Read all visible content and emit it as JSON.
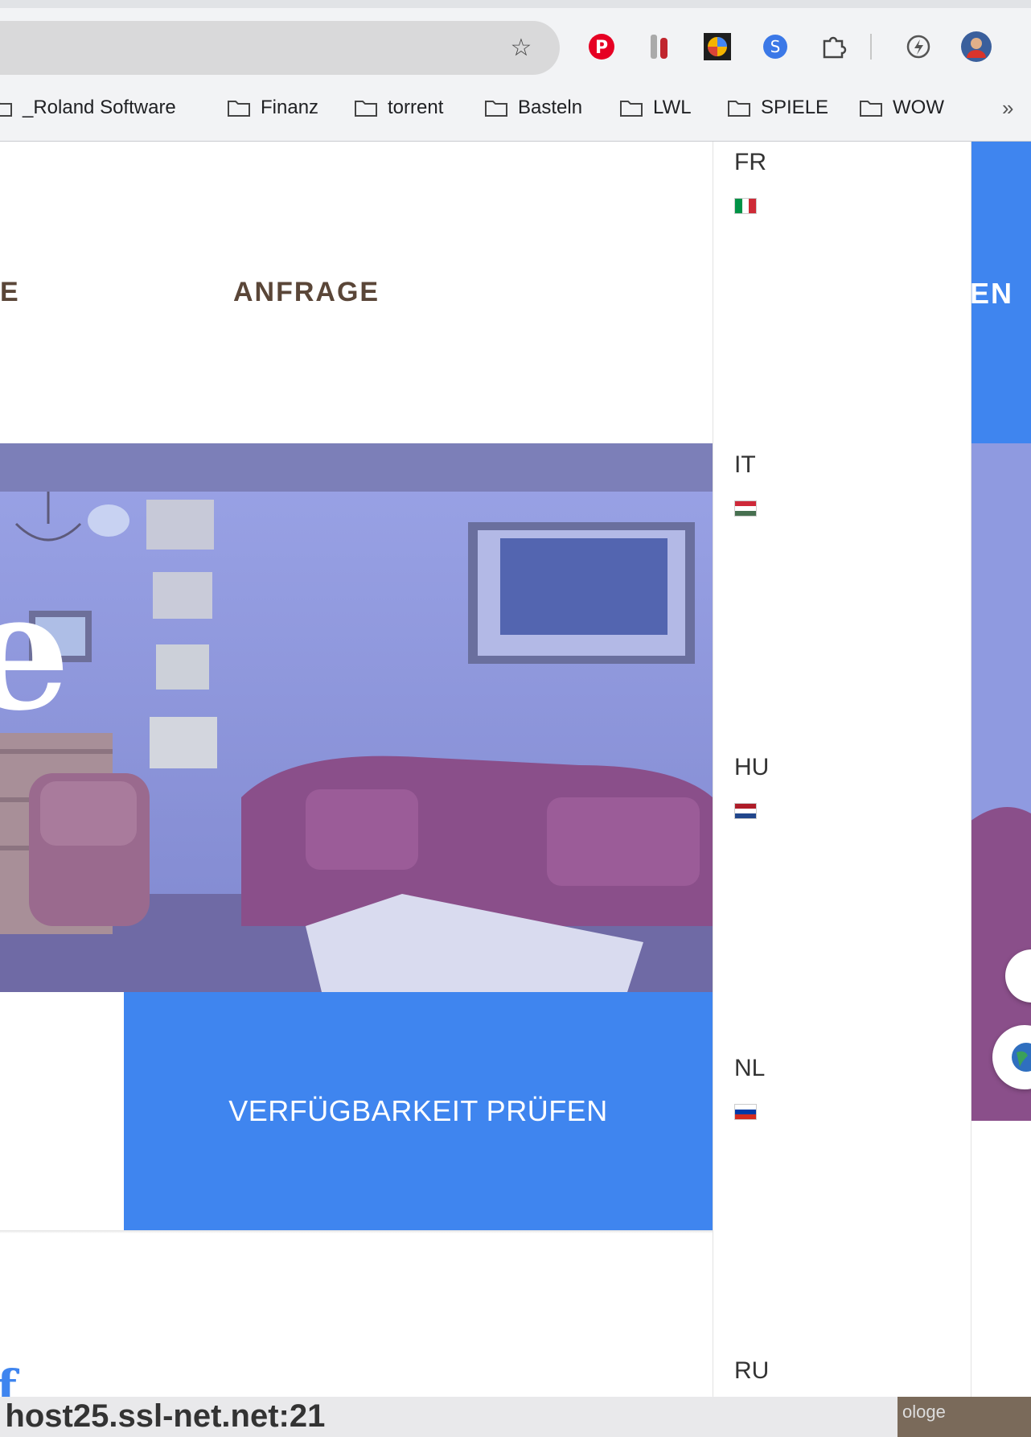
{
  "browser": {
    "bookmarks": [
      "_Roland Software",
      "Finanz",
      "torrent",
      "Basteln",
      "LWL",
      "SPIELE",
      "WOW"
    ],
    "extensions": [
      "pinterest-icon",
      "wine-tools-icon",
      "colorful-tile-icon",
      "blue-s-icon",
      "puzzle-extensions-icon",
      "lightning-icon",
      "profile-avatar-icon"
    ]
  },
  "page": {
    "nav_fragment": "E",
    "nav_anfrage": "ANFRAGE",
    "right_nav_fragment": "EN",
    "hero_letter": "e",
    "booking_button": "VERFÜGBARKEIT PRÜFEN",
    "footer_letter": "f"
  },
  "languages": [
    {
      "code": "FR",
      "flag_colors": [
        "#009246",
        "#ffffff",
        "#ce2b37"
      ],
      "flag_orientation": "vertical"
    },
    {
      "code": "IT",
      "flag_colors": [
        "#ce2939",
        "#ffffff",
        "#477050"
      ],
      "flag_orientation": "horizontal"
    },
    {
      "code": "HU",
      "flag_colors": [
        "#ae1c28",
        "#ffffff",
        "#21468b"
      ],
      "flag_orientation": "horizontal"
    },
    {
      "code": "NL",
      "flag_colors": [
        "#ffffff",
        "#0039a6",
        "#d52b1e"
      ],
      "flag_orientation": "horizontal"
    },
    {
      "code": "RU"
    }
  ],
  "status": {
    "text": ": host25.ssl-net.net:21",
    "right_fragment": "ologe"
  },
  "colors": {
    "accent_blue": "#3f85ef",
    "nav_brown": "#5a4638"
  }
}
